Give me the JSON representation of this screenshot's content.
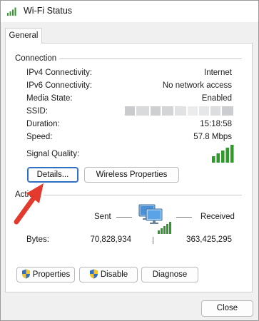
{
  "window": {
    "title": "Wi-Fi Status"
  },
  "tabs": [
    {
      "label": "General"
    }
  ],
  "connection": {
    "section_label": "Connection",
    "rows": [
      {
        "label": "IPv4 Connectivity:",
        "value": "Internet"
      },
      {
        "label": "IPv6 Connectivity:",
        "value": "No network access"
      },
      {
        "label": "Media State:",
        "value": "Enabled"
      },
      {
        "label": "SSID:",
        "value": ""
      },
      {
        "label": "Duration:",
        "value": "15:18:58"
      },
      {
        "label": "Speed:",
        "value": "57.8 Mbps"
      }
    ],
    "signal_label": "Signal Quality:",
    "details_button": "Details...",
    "wireless_button": "Wireless Properties"
  },
  "activity": {
    "section_label": "Activity",
    "sent_label": "Sent",
    "received_label": "Received",
    "bytes_label": "Bytes:",
    "bytes_sent": "70,828,934",
    "bytes_received": "363,425,295"
  },
  "buttons": {
    "properties": "Properties",
    "disable": "Disable",
    "diagnose": "Diagnose",
    "close": "Close"
  },
  "icons": {
    "title": "wifi-signal-icon",
    "signal": "signal-bars-icon",
    "network": "network-computers-icon",
    "shield": "uac-shield-icon",
    "annotation": "red-arrow-annotation"
  },
  "colors": {
    "signal_green": "#2e9a2a",
    "focus_blue": "#2f6fc4",
    "arrow_red": "#e23b2e"
  }
}
